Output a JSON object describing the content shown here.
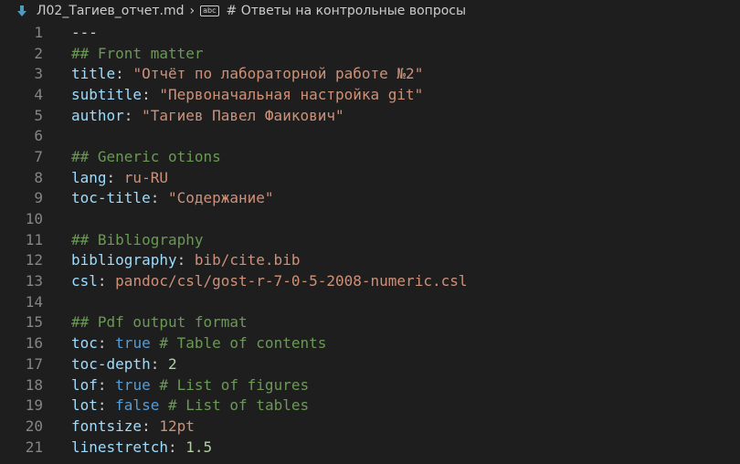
{
  "breadcrumb": {
    "file_name": "Л02_Тагиев_отчет.md",
    "section": "# Ответы на контрольные вопросы"
  },
  "lines": [
    {
      "n": "1",
      "tokens": [
        {
          "t": "---",
          "c": "plain"
        }
      ]
    },
    {
      "n": "2",
      "tokens": [
        {
          "t": "## Front matter",
          "c": "comment"
        }
      ]
    },
    {
      "n": "3",
      "tokens": [
        {
          "t": "title",
          "c": "key"
        },
        {
          "t": ": ",
          "c": "punct"
        },
        {
          "t": "\"Отчёт по лабораторной работе №2\"",
          "c": "str"
        }
      ]
    },
    {
      "n": "4",
      "tokens": [
        {
          "t": "subtitle",
          "c": "key"
        },
        {
          "t": ": ",
          "c": "punct"
        },
        {
          "t": "\"Первоначальная настройка git\"",
          "c": "str"
        }
      ]
    },
    {
      "n": "5",
      "tokens": [
        {
          "t": "author",
          "c": "key"
        },
        {
          "t": ": ",
          "c": "punct"
        },
        {
          "t": "\"Тагиев Павел Фаикович\"",
          "c": "str"
        }
      ]
    },
    {
      "n": "6",
      "tokens": []
    },
    {
      "n": "7",
      "tokens": [
        {
          "t": "## Generic otions",
          "c": "comment"
        }
      ]
    },
    {
      "n": "8",
      "tokens": [
        {
          "t": "lang",
          "c": "key"
        },
        {
          "t": ": ",
          "c": "punct"
        },
        {
          "t": "ru-RU",
          "c": "str"
        }
      ]
    },
    {
      "n": "9",
      "tokens": [
        {
          "t": "toc-title",
          "c": "key"
        },
        {
          "t": ": ",
          "c": "punct"
        },
        {
          "t": "\"Содержание\"",
          "c": "str"
        }
      ]
    },
    {
      "n": "10",
      "tokens": []
    },
    {
      "n": "11",
      "tokens": [
        {
          "t": "## Bibliography",
          "c": "comment"
        }
      ]
    },
    {
      "n": "12",
      "tokens": [
        {
          "t": "bibliography",
          "c": "key"
        },
        {
          "t": ": ",
          "c": "punct"
        },
        {
          "t": "bib/cite.bib",
          "c": "str"
        }
      ]
    },
    {
      "n": "13",
      "tokens": [
        {
          "t": "csl",
          "c": "key"
        },
        {
          "t": ": ",
          "c": "punct"
        },
        {
          "t": "pandoc/csl/gost-r-7-0-5-2008-numeric.csl",
          "c": "str"
        }
      ]
    },
    {
      "n": "14",
      "tokens": []
    },
    {
      "n": "15",
      "tokens": [
        {
          "t": "## Pdf output format",
          "c": "comment"
        }
      ]
    },
    {
      "n": "16",
      "tokens": [
        {
          "t": "toc",
          "c": "key"
        },
        {
          "t": ": ",
          "c": "punct"
        },
        {
          "t": "true",
          "c": "kw"
        },
        {
          "t": " # Table of contents",
          "c": "comment"
        }
      ]
    },
    {
      "n": "17",
      "tokens": [
        {
          "t": "toc-depth",
          "c": "key"
        },
        {
          "t": ": ",
          "c": "punct"
        },
        {
          "t": "2",
          "c": "num"
        }
      ]
    },
    {
      "n": "18",
      "tokens": [
        {
          "t": "lof",
          "c": "key"
        },
        {
          "t": ": ",
          "c": "punct"
        },
        {
          "t": "true",
          "c": "kw"
        },
        {
          "t": " # List of figures",
          "c": "comment"
        }
      ]
    },
    {
      "n": "19",
      "tokens": [
        {
          "t": "lot",
          "c": "key"
        },
        {
          "t": ": ",
          "c": "punct"
        },
        {
          "t": "false",
          "c": "kw"
        },
        {
          "t": " # List of tables",
          "c": "comment"
        }
      ]
    },
    {
      "n": "20",
      "tokens": [
        {
          "t": "fontsize",
          "c": "key"
        },
        {
          "t": ": ",
          "c": "punct"
        },
        {
          "t": "12pt",
          "c": "str"
        }
      ]
    },
    {
      "n": "21",
      "tokens": [
        {
          "t": "linestretch",
          "c": "key"
        },
        {
          "t": ": ",
          "c": "punct"
        },
        {
          "t": "1.5",
          "c": "num"
        }
      ]
    }
  ]
}
